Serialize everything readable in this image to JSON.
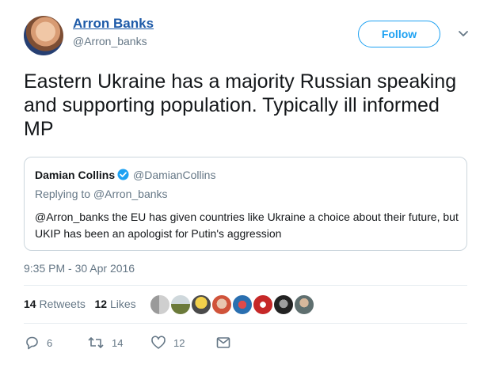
{
  "author": {
    "name": "Arron Banks",
    "handle": "@Arron_banks"
  },
  "follow_label": "Follow",
  "tweet_text": "Eastern Ukraine has a majority Russian speaking and supporting population. Typically ill informed MP",
  "quoted": {
    "name": "Damian Collins",
    "handle": "@DamianCollins",
    "replying_to": "Replying to @Arron_banks",
    "text": "@Arron_banks the EU has given countries like Ukraine a choice about their future, but UKIP has been an apologist for Putin's aggression"
  },
  "timestamp": "9:35 PM - 30 Apr 2016",
  "stats": {
    "retweets_count": "14",
    "retweets_label": "Retweets",
    "likes_count": "12",
    "likes_label": "Likes"
  },
  "actions": {
    "reply_count": "6",
    "retweet_count": "14",
    "like_count": "12"
  },
  "colors": {
    "link_blue": "#1da1f2",
    "name_blue": "#1d5aa8",
    "muted": "#657786"
  },
  "icons": [
    "chevron-down-icon",
    "verified-badge-icon",
    "reply-icon",
    "retweet-icon",
    "like-icon",
    "message-icon"
  ]
}
